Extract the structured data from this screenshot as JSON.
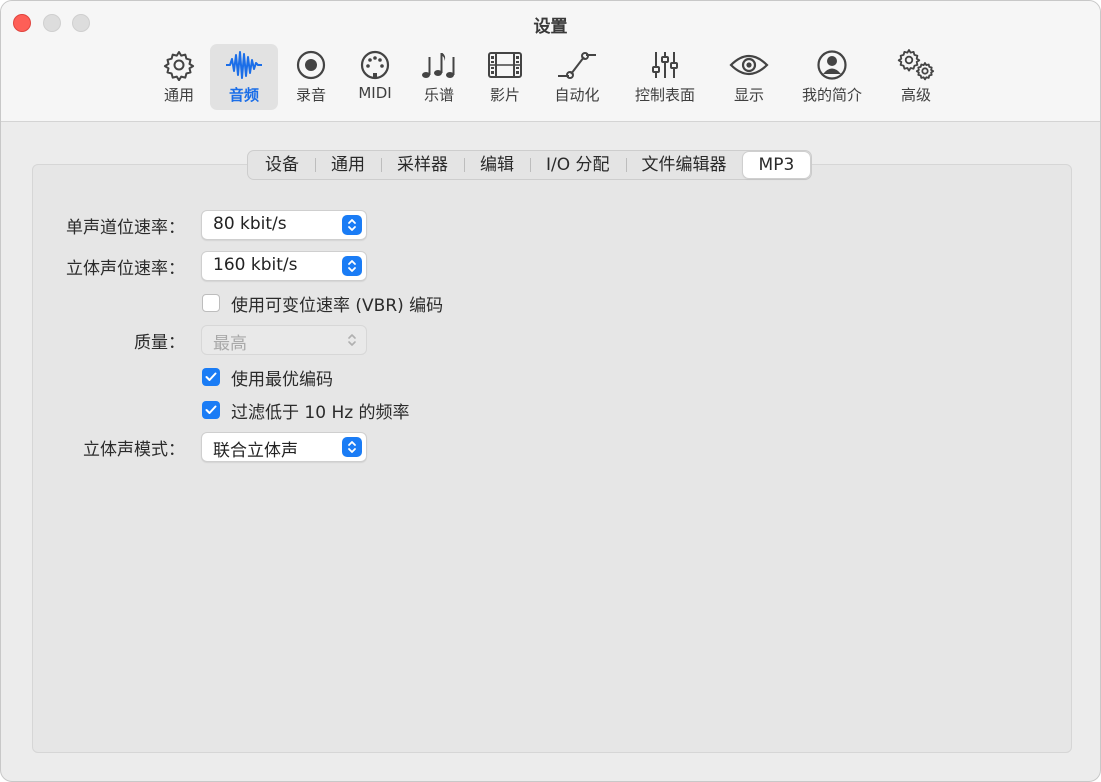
{
  "window": {
    "title": "设置",
    "colors": {
      "accent": "#1a7cf5",
      "close": "#fe5f57"
    }
  },
  "toolbar": {
    "items": [
      {
        "label": "通用",
        "icon": "gear-icon"
      },
      {
        "label": "音频",
        "icon": "waveform-icon",
        "selected": true
      },
      {
        "label": "录音",
        "icon": "record-icon"
      },
      {
        "label": "MIDI",
        "icon": "midi-port-icon"
      },
      {
        "label": "乐谱",
        "icon": "music-notes-icon"
      },
      {
        "label": "影片",
        "icon": "film-icon"
      },
      {
        "label": "自动化",
        "icon": "automation-curve-icon"
      },
      {
        "label": "控制表面",
        "icon": "sliders-icon"
      },
      {
        "label": "显示",
        "icon": "eye-icon"
      },
      {
        "label": "我的简介",
        "icon": "person-icon"
      },
      {
        "label": "高级",
        "icon": "gears-icon"
      }
    ]
  },
  "tabs": {
    "items": [
      "设备",
      "通用",
      "采样器",
      "编辑",
      "I/O 分配",
      "文件编辑器",
      "MP3"
    ],
    "selected": "MP3"
  },
  "form": {
    "mono_bitrate": {
      "label": "单声道位速率：",
      "value": "80 kbit/s"
    },
    "stereo_bitrate": {
      "label": "立体声位速率：",
      "value": "160 kbit/s"
    },
    "vbr": {
      "label": "使用可变位速率 (VBR) 编码",
      "checked": false
    },
    "quality": {
      "label": "质量：",
      "value": "最高",
      "enabled": false
    },
    "best_encoding": {
      "label": "使用最优编码",
      "checked": true
    },
    "filter_low": {
      "label": "过滤低于 10 Hz 的频率",
      "checked": true
    },
    "stereo_mode": {
      "label": "立体声模式：",
      "value": "联合立体声"
    }
  }
}
